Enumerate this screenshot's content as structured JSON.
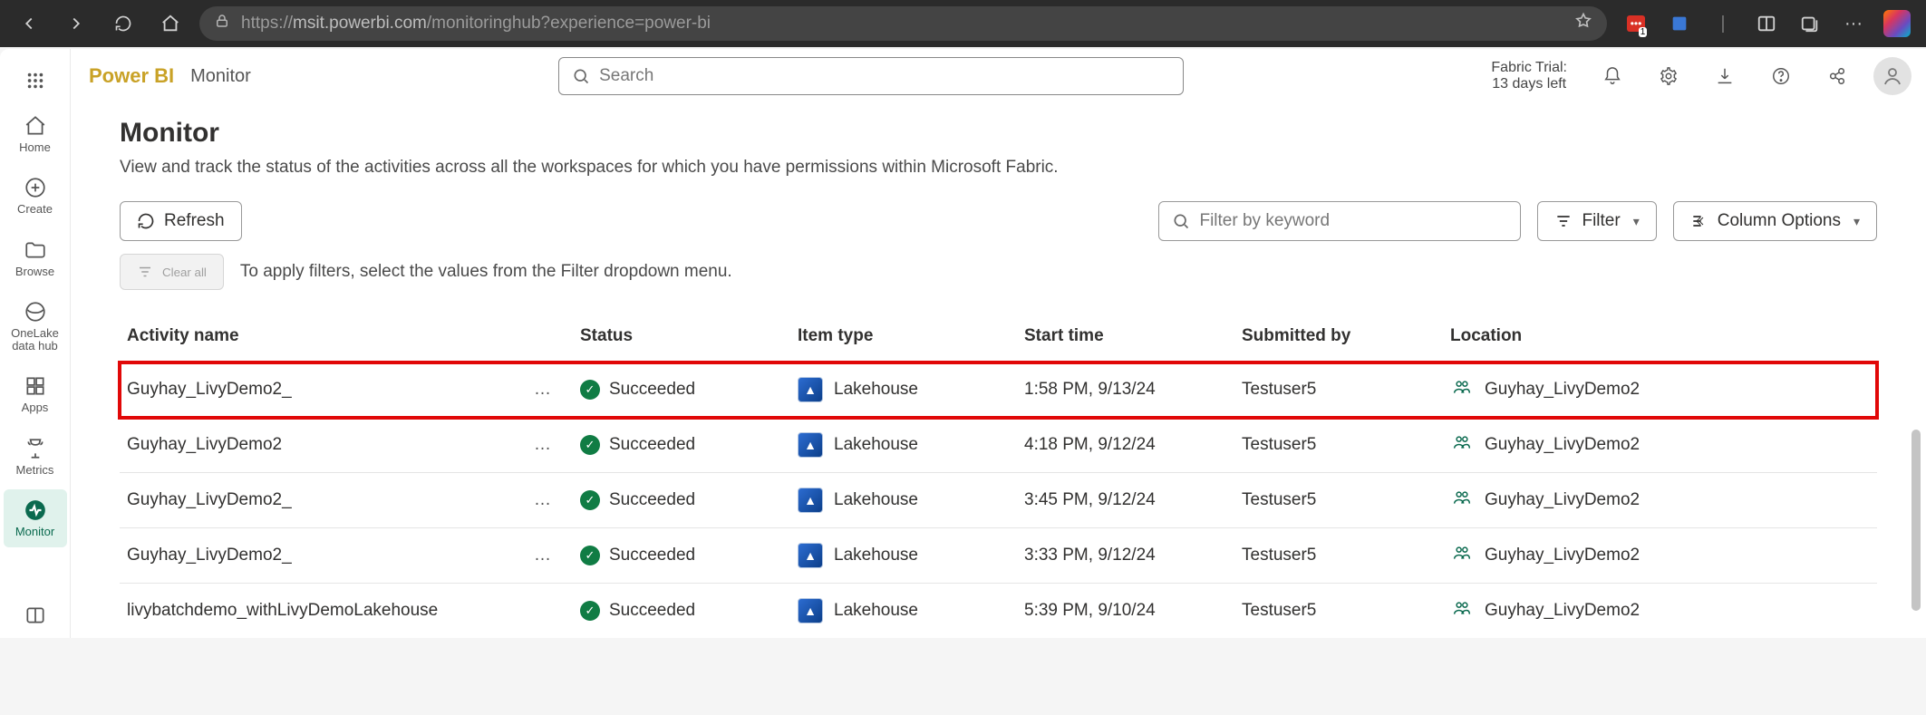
{
  "browser": {
    "url_prefix": "https://",
    "url_host": "msit.powerbi.com",
    "url_path": "/monitoringhub?experience=power-bi"
  },
  "header": {
    "brand": "Power BI",
    "crumb": "Monitor",
    "search_placeholder": "Search",
    "trial_line1": "Fabric Trial:",
    "trial_line2": "13 days left"
  },
  "rail": {
    "home": "Home",
    "create": "Create",
    "browse": "Browse",
    "onelake": "OneLake data hub",
    "apps": "Apps",
    "metrics": "Metrics",
    "monitor": "Monitor"
  },
  "page": {
    "title": "Monitor",
    "subtitle": "View and track the status of the activities across all the workspaces for which you have permissions within Microsoft Fabric.",
    "refresh": "Refresh",
    "filter_placeholder": "Filter by keyword",
    "filter_btn": "Filter",
    "column_options": "Column Options",
    "clear_all": "Clear all",
    "filter_hint": "To apply filters, select the values from the Filter dropdown menu."
  },
  "table": {
    "headers": {
      "activity": "Activity name",
      "status": "Status",
      "item_type": "Item type",
      "start": "Start time",
      "submitted": "Submitted by",
      "location": "Location"
    },
    "rows": [
      {
        "activity": "Guyhay_LivyDemo2_",
        "status": "Succeeded",
        "type": "Lakehouse",
        "start": "1:58 PM, 9/13/24",
        "submitted": "Testuser5",
        "location": "Guyhay_LivyDemo2",
        "highlight": true,
        "ell": "…"
      },
      {
        "activity": "Guyhay_LivyDemo2",
        "status": "Succeeded",
        "type": "Lakehouse",
        "start": "4:18 PM, 9/12/24",
        "submitted": "Testuser5",
        "location": "Guyhay_LivyDemo2",
        "ell": "…"
      },
      {
        "activity": "Guyhay_LivyDemo2_",
        "status": "Succeeded",
        "type": "Lakehouse",
        "start": "3:45 PM, 9/12/24",
        "submitted": "Testuser5",
        "location": "Guyhay_LivyDemo2",
        "ell": "…"
      },
      {
        "activity": "Guyhay_LivyDemo2_",
        "status": "Succeeded",
        "type": "Lakehouse",
        "start": "3:33 PM, 9/12/24",
        "submitted": "Testuser5",
        "location": "Guyhay_LivyDemo2",
        "ell": "…"
      },
      {
        "activity": "livybatchdemo_withLivyDemoLakehouse",
        "status": "Succeeded",
        "type": "Lakehouse",
        "start": "5:39 PM, 9/10/24",
        "submitted": "Testuser5",
        "location": "Guyhay_LivyDemo2"
      }
    ]
  }
}
